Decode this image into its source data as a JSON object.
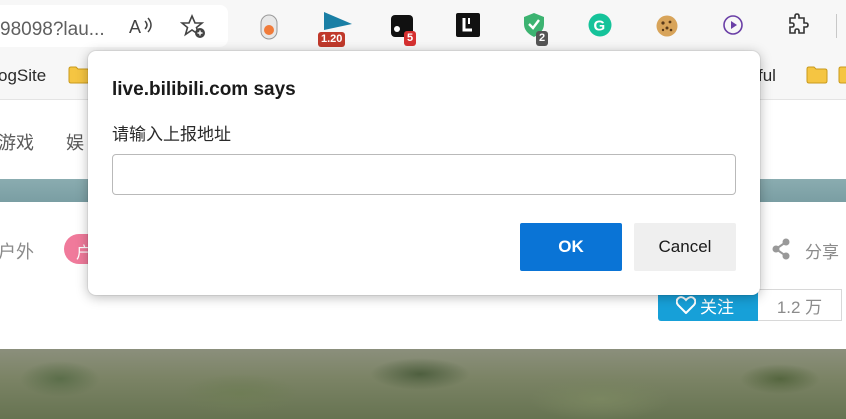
{
  "browser": {
    "url_fragment": "98098?lau...",
    "extensions": {
      "badge_1": "1.20",
      "badge_2": "5",
      "badge_3": "2"
    },
    "bookmarks": {
      "left_label": "ogSite",
      "right_label": "ful"
    },
    "bookmark_folder_color": "#f5c542"
  },
  "page": {
    "nav": [
      "游戏",
      "娱"
    ],
    "tag_label": "户外",
    "pill_char": "户",
    "share_label": "分享",
    "follow_label": "关注",
    "follower_count": "1.2 万",
    "accent_color": "#17a0d8",
    "banner_color": "#7a9ea3"
  },
  "dialog": {
    "title": "live.bilibili.com says",
    "message": "请输入上报地址",
    "input_value": "",
    "ok_label": "OK",
    "cancel_label": "Cancel",
    "ok_color": "#0a74d6"
  }
}
